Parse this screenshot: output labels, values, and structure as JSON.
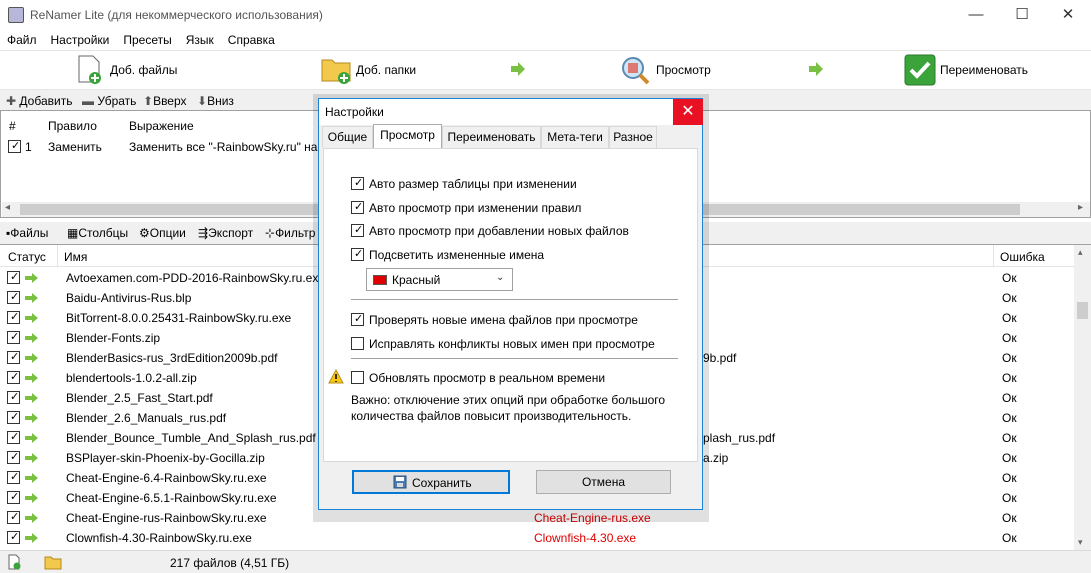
{
  "window": {
    "title": "ReNamer Lite (для некоммерческого использования)",
    "minimize": "—",
    "maximize": "☐",
    "close": "✕"
  },
  "menu": [
    "Файл",
    "Настройки",
    "Пресеты",
    "Язык",
    "Справка"
  ],
  "toolbar": {
    "add_files": "Доб. файлы",
    "add_folders": "Доб. папки",
    "preview": "Просмотр",
    "rename": "Переименовать"
  },
  "rules_toolbar": {
    "add": "Добавить",
    "remove": "Убрать",
    "up": "Вверх",
    "down": "Вниз"
  },
  "rules_table": {
    "headers": [
      "#",
      "Правило",
      "Выражение"
    ],
    "rows": [
      {
        "num": "1",
        "rule": "Заменить",
        "expression": "Заменить все \"-RainbowSky.ru\" на"
      }
    ]
  },
  "files_toolbar": {
    "files": "Файлы",
    "columns": "Столбцы",
    "options": "Опции",
    "export": "Экспорт",
    "filter": "Фильтр"
  },
  "files_table": {
    "headers": {
      "status": "Статус",
      "name": "Имя",
      "error": "Ошибка"
    },
    "rows": [
      {
        "name": "Avtoexamen.com-PDD-2016-RainbowSky.ru.exe",
        "new_name": "",
        "error": "Ок"
      },
      {
        "name": "Baidu-Antivirus-Rus.blp",
        "new_name": "",
        "error": "Ок"
      },
      {
        "name": "BitTorrent-8.0.0.25431-RainbowSky.ru.exe",
        "new_name": "",
        "error": "Ок"
      },
      {
        "name": "Blender-Fonts.zip",
        "new_name": "",
        "error": "Ок"
      },
      {
        "name": "BlenderBasics-rus_3rdEdition2009b.pdf",
        "new_name": "9b.pdf",
        "error": "Ок"
      },
      {
        "name": "blendertools-1.0.2-all.zip",
        "new_name": "",
        "error": "Ок"
      },
      {
        "name": "Blender_2.5_Fast_Start.pdf",
        "new_name": "",
        "error": "Ок"
      },
      {
        "name": "Blender_2.6_Manuals_rus.pdf",
        "new_name": "",
        "error": "Ок"
      },
      {
        "name": "Blender_Bounce_Tumble_And_Splash_rus.pdf",
        "new_name": "plash_rus.pdf",
        "error": "Ок"
      },
      {
        "name": "BSPlayer-skin-Phoenix-by-Gocilla.zip",
        "new_name": "a.zip",
        "error": "Ок"
      },
      {
        "name": "Cheat-Engine-6.4-RainbowSky.ru.exe",
        "new_name": "",
        "error": "Ок"
      },
      {
        "name": "Cheat-Engine-6.5.1-RainbowSky.ru.exe",
        "new_name": "",
        "error": "Ок"
      },
      {
        "name": "Cheat-Engine-rus-RainbowSky.ru.exe",
        "new_name": "Cheat-Engine-rus.exe",
        "error": "Ок"
      },
      {
        "name": "Clownfish-4.30-RainbowSky.ru.exe",
        "new_name": "Clownfish-4.30.exe",
        "error": "Ок"
      }
    ]
  },
  "statusbar": {
    "count": "217 файлов (4,51 ГБ)"
  },
  "dialog": {
    "title": "Настройки",
    "close": "✕",
    "tabs": [
      "Общие",
      "Просмотр",
      "Переименовать",
      "Мета-теги",
      "Разное"
    ],
    "options": [
      {
        "label": "Авто размер таблицы при изменении",
        "checked": true
      },
      {
        "label": "Авто просмотр при изменении правил",
        "checked": true
      },
      {
        "label": "Авто просмотр при добавлении новых файлов",
        "checked": true
      },
      {
        "label": "Подсветить измененные имена",
        "checked": true
      }
    ],
    "color_select": "Красный",
    "options2": [
      {
        "label": "Проверять новые имена файлов при просмотре",
        "checked": true
      },
      {
        "label": "Исправлять конфликты новых имен при просмотре",
        "checked": false
      }
    ],
    "realtime_option": {
      "label": "Обновлять просмотр в реальном времени",
      "checked": false
    },
    "note": "Важно: отключение этих опций при обработке большого количества файлов повысит производительность.",
    "save": "Сохранить",
    "cancel": "Отмена"
  },
  "colors": {
    "accent": "#0078d7",
    "highlight_text": "#e00000",
    "close_red": "#e81123",
    "check_green": "#3aa33a"
  }
}
